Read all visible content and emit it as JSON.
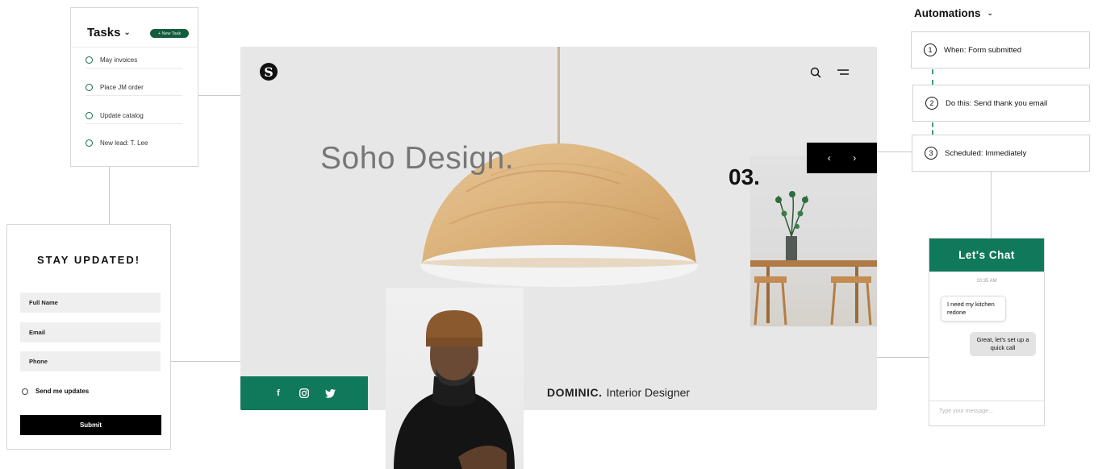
{
  "tasks": {
    "title": "Tasks",
    "new_task_label": "+ New Task",
    "items": [
      "May invoices",
      "Place JM order",
      "Update catalog",
      "New lead: T. Lee"
    ]
  },
  "signup_form": {
    "title": "STAY UPDATED!",
    "fields": [
      "Full Name",
      "Email",
      "Phone"
    ],
    "checkbox_label": "Send me updates",
    "submit_label": "Submit"
  },
  "site": {
    "hero_title": "Soho Design.",
    "slide_number": "03.",
    "designer_name": "DOMINIC.",
    "designer_role": "Interior Designer",
    "accent_color": "#11795b",
    "social_icons": [
      "facebook-icon",
      "instagram-icon",
      "twitter-icon"
    ]
  },
  "automations": {
    "title": "Automations",
    "steps": [
      {
        "num": "1",
        "label": "When: Form submitted"
      },
      {
        "num": "2",
        "label": "Do this: Send thank you email"
      },
      {
        "num": "3",
        "label": "Scheduled: Immediately"
      }
    ]
  },
  "chat": {
    "title": "Let's Chat",
    "time": "10:35 AM",
    "incoming": "I need my kitchen redone",
    "outgoing": "Great, let's set up a quick call",
    "input_placeholder": "Type your message..."
  }
}
